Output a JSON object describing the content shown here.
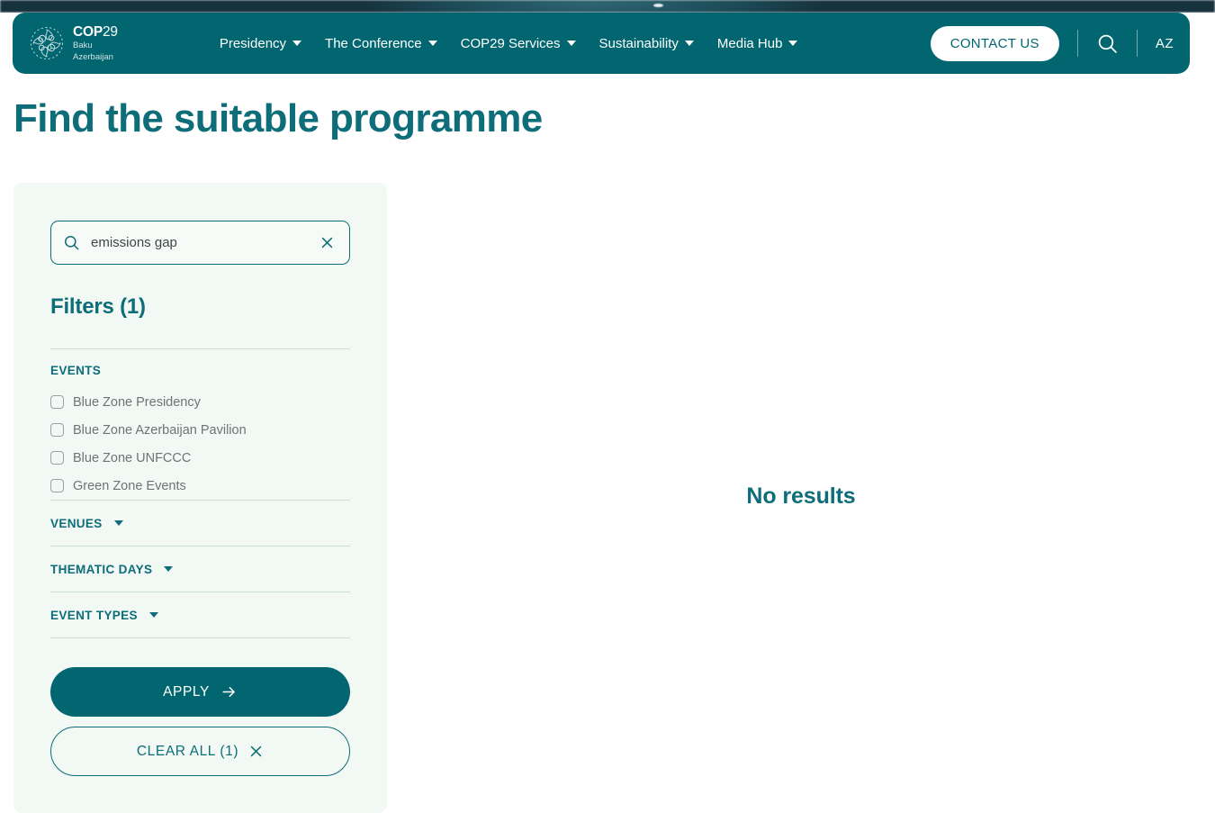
{
  "header": {
    "logo": {
      "icon": "cop29-floral-emblem-icon",
      "title_main": "COP",
      "title_num": "29",
      "sub_line1": "Baku",
      "sub_line2": "Azerbaijan"
    },
    "nav_items": [
      {
        "label": "Presidency",
        "caret": "chevron-down-icon"
      },
      {
        "label": "The Conference",
        "caret": "chevron-down-icon"
      },
      {
        "label": "COP29 Services",
        "caret": "chevron-down-icon"
      },
      {
        "label": "Sustainability",
        "caret": "chevron-down-icon"
      },
      {
        "label": "Media Hub",
        "caret": "chevron-down-icon"
      }
    ],
    "contact_label": "CONTACT US",
    "search_icon": "search-icon",
    "language": "AZ",
    "bar_color": "#026670"
  },
  "page": {
    "title": "Find the suitable programme",
    "title_color": "#0d6d78"
  },
  "sidebar": {
    "search": {
      "value": "emissions gap",
      "placeholder": "Search",
      "icon": "search-icon",
      "clear_icon": "close-icon"
    },
    "filters_heading": "Filters (1)",
    "events_group": {
      "label": "EVENTS",
      "options": [
        {
          "label": "Blue Zone Presidency",
          "checked": false
        },
        {
          "label": "Blue Zone Azerbaijan Pavilion",
          "checked": false
        },
        {
          "label": "Blue Zone UNFCCC",
          "checked": false
        },
        {
          "label": "Green Zone Events",
          "checked": false
        }
      ]
    },
    "collapsed_groups": [
      {
        "label": "VENUES",
        "caret": "chevron-down-icon",
        "expanded": false
      },
      {
        "label": "THEMATIC DAYS",
        "caret": "chevron-down-icon",
        "expanded": false
      },
      {
        "label": "EVENT TYPES",
        "caret": "chevron-down-icon",
        "expanded": false
      }
    ],
    "apply_label": "APPLY",
    "apply_icon": "arrow-right-icon",
    "clear_all_label": "CLEAR ALL (1)",
    "clear_all_icon": "close-icon",
    "panel_color": "#f2f8f4"
  },
  "results": {
    "empty_message": "No results"
  }
}
